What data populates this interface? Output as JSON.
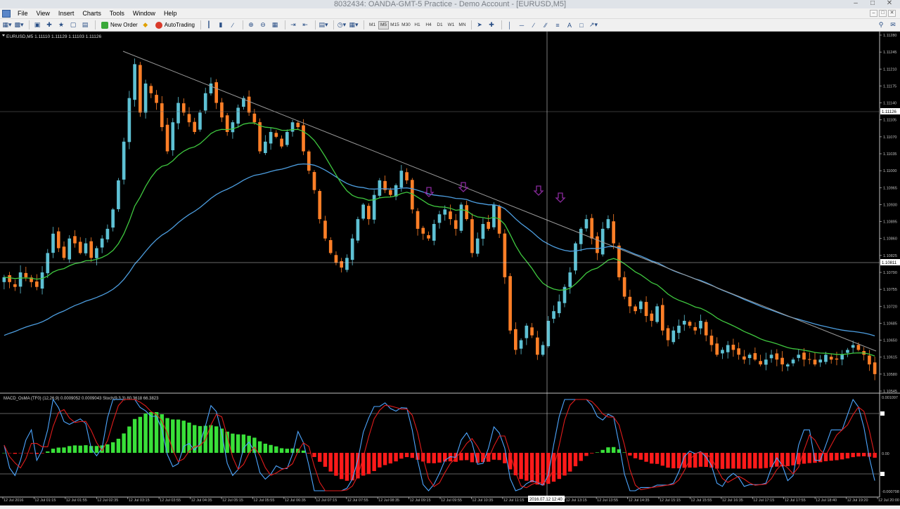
{
  "window": {
    "title": "8032434: OANDA-GMT-5 Practice - Demo Account - [EURUSD,M5]",
    "controls": [
      "–",
      "□",
      "✕"
    ]
  },
  "menu": {
    "items": [
      "File",
      "View",
      "Insert",
      "Charts",
      "Tools",
      "Window",
      "Help"
    ],
    "mdi_controls": [
      "–",
      "□",
      "✕"
    ]
  },
  "toolbar": {
    "new_order_label": "New Order",
    "autotrading_label": "AutoTrading",
    "timeframes": [
      "M1",
      "M5",
      "M15",
      "M30",
      "H1",
      "H4",
      "D1",
      "W1",
      "MN"
    ],
    "active_timeframe": "M5",
    "drawing_text_tool": "A"
  },
  "chart": {
    "symbol_info": "EURUSD,M5  1.11110 1.11129 1.11103 1.11126",
    "price_labels": [
      "1.11280",
      "1.11245",
      "1.11210",
      "1.11175",
      "1.11140",
      "1.11105",
      "1.11070",
      "1.11035",
      "1.11000",
      "1.10965",
      "1.10930",
      "1.10895",
      "1.10860",
      "1.10825",
      "1.10790",
      "1.10755",
      "1.10720",
      "1.10685",
      "1.10650",
      "1.10615",
      "1.10580",
      "1.10545"
    ],
    "current_price": "1.11126",
    "crosshair_price": "1.10811",
    "colors": {
      "background": "#000000",
      "bull": "#5ec1d4",
      "bear": "#ff7f27",
      "ma_fast": "#3fc83f",
      "ma_slow": "#4d9ee0",
      "trendline": "#9a9a9a",
      "arrows": "#8a2a9e",
      "grid_text": "#c0c0c0"
    },
    "arrows_icon": "down-arrow-icon"
  },
  "indicator": {
    "label": "MACD_OsMA (TF0) (12,26,9)  0.0009052 0.0009043  Stoch(9,3,3) 80.3618 66.3823",
    "scale_labels": [
      "0.001097",
      "0.00",
      "-0.000798"
    ],
    "colors": {
      "hist_pos": "#39e039",
      "hist_neg": "#ff1a1a",
      "stoch_main": "#4da6ff",
      "stoch_signal": "#e01c1c"
    }
  },
  "time_axis": {
    "labels": [
      "12 Jul 2016",
      "12 Jul 01:15",
      "12 Jul 01:55",
      "12 Jul 02:35",
      "12 Jul 03:15",
      "12 Jul 03:55",
      "12 Jul 04:35",
      "12 Jul 05:15",
      "12 Jul 05:55",
      "12 Jul 06:35",
      "12 Jul 07:15",
      "12 Jul 07:55",
      "12 Jul 08:35",
      "12 Jul 09:15",
      "12 Jul 09:55",
      "12 Jul 10:35",
      "12 Jul 11:15",
      "12 Jul 1",
      "12 Jul 13:15",
      "12 Jul 13:55",
      "12 Jul 14:35",
      "12 Jul 15:15",
      "12 Jul 15:55",
      "12 Jul 16:35",
      "12 Jul 17:15",
      "12 Jul 17:55",
      "12 Jul 18:40",
      "12 Jul 19:20",
      "12 Jul 20:00"
    ],
    "crosshair_time": "2016.07.12 12:40"
  },
  "chart_data": {
    "type": "candlestick",
    "symbol": "EURUSD",
    "timeframe": "M5",
    "ylim": [
      1.10545,
      1.1128
    ],
    "series_close": [
      1.1078,
      1.1077,
      1.1076,
      1.1079,
      1.1078,
      1.1077,
      1.1076,
      1.1079,
      1.1083,
      1.1087,
      1.1084,
      1.1082,
      1.1086,
      1.1085,
      1.1083,
      1.1085,
      1.1082,
      1.1084,
      1.1086,
      1.1088,
      1.1092,
      1.1098,
      1.1106,
      1.1115,
      1.1122,
      1.1112,
      1.1118,
      1.1116,
      1.1114,
      1.1109,
      1.1104,
      1.111,
      1.1114,
      1.1112,
      1.111,
      1.1108,
      1.1112,
      1.1116,
      1.1118,
      1.1114,
      1.1111,
      1.1108,
      1.111,
      1.1113,
      1.1115,
      1.1112,
      1.111,
      1.1104,
      1.1106,
      1.1108,
      1.1107,
      1.1105,
      1.1108,
      1.111,
      1.1109,
      1.1104,
      1.11,
      1.1096,
      1.109,
      1.1086,
      1.1083,
      1.1081,
      1.108,
      1.1082,
      1.1086,
      1.109,
      1.1093,
      1.109,
      1.1095,
      1.1098,
      1.1096,
      1.1095,
      1.1097,
      1.11,
      1.1098,
      1.1092,
      1.1088,
      1.1087,
      1.1086,
      1.1089,
      1.1091,
      1.1092,
      1.109,
      1.1088,
      1.1093,
      1.109,
      1.1083,
      1.1086,
      1.1089,
      1.1088,
      1.1093,
      1.1087,
      1.1078,
      1.1067,
      1.1063,
      1.1065,
      1.1068,
      1.1066,
      1.1062,
      1.1064,
      1.1069,
      1.1071,
      1.1073,
      1.1076,
      1.1079,
      1.1085,
      1.1088,
      1.109,
      1.1086,
      1.1083,
      1.1088,
      1.109,
      1.1085,
      1.1078,
      1.1074,
      1.1072,
      1.1071,
      1.1073,
      1.107,
      1.1069,
      1.1072,
      1.1067,
      1.1065,
      1.1067,
      1.1068,
      1.1069,
      1.1068,
      1.1067,
      1.1069,
      1.1066,
      1.1064,
      1.1062,
      1.1063,
      1.1064,
      1.1063,
      1.1062,
      1.1061,
      1.1062,
      1.1061,
      1.106,
      1.1061,
      1.1062,
      1.1061,
      1.106,
      1.106,
      1.1061,
      1.1062,
      1.1061,
      1.1061,
      1.106,
      1.1061,
      1.1062,
      1.1061,
      1.1061,
      1.1062,
      1.1063,
      1.1064,
      1.1063,
      1.1062,
      1.106,
      1.1058
    ]
  }
}
